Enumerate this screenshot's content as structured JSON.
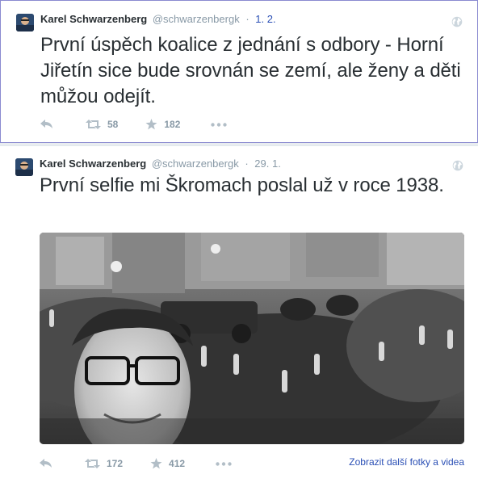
{
  "tweets": [
    {
      "fullname": "Karel Schwarzenberg",
      "handle": "@schwarzenbergk",
      "separator": "·",
      "date": "1. 2.",
      "text": "První úspěch koalice z jednání s odbory - Horní Jiřetín sice bude srovnán se zemí, ale ženy a děti můžou odejít.",
      "retweets": "58",
      "favorites": "182"
    },
    {
      "fullname": "Karel Schwarzenberg",
      "handle": "@schwarzenbergk",
      "separator": "·",
      "date": "29. 1.",
      "text": "První selfie mi Škromach poslal už v roce 1938.",
      "retweets": "172",
      "favorites": "412",
      "more_media_label": "Zobrazit další fotky a videa"
    }
  ],
  "icons": {
    "reply": "reply-icon",
    "retweet": "retweet-icon",
    "favorite": "star-icon",
    "more": "more-dots-icon",
    "globe": "globe-icon"
  },
  "colors": {
    "link": "#2a4fb5",
    "muted": "#8899a6",
    "text": "#292f33"
  }
}
